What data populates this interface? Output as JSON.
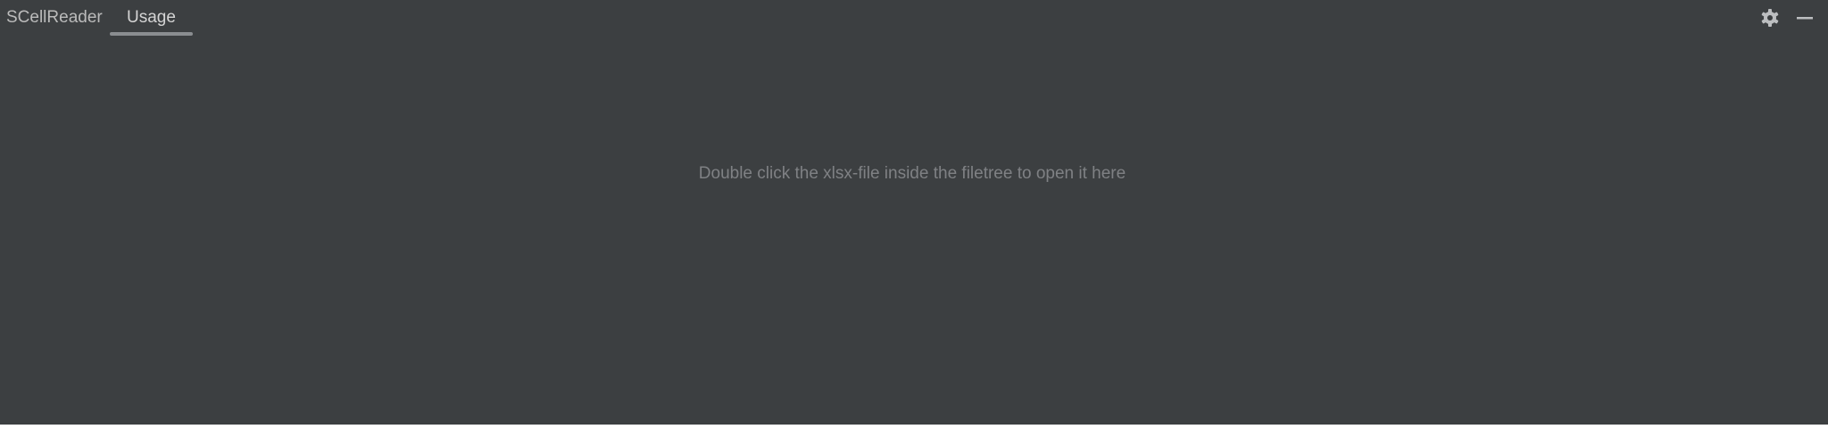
{
  "tool_window": {
    "title": "SCellReader",
    "tabs": [
      {
        "label": "Usage",
        "selected": true
      }
    ],
    "actions": [
      {
        "icon": "gear-icon"
      },
      {
        "icon": "minimize-icon"
      }
    ],
    "empty_text": "Double click the xlsx-file inside the filetree to open it here"
  },
  "colors": {
    "background": "#3c3f41",
    "text": "#bbbbbb",
    "muted_text": "#7f8184",
    "tab_underline": "#8a8d90",
    "icon": "#bcbec0"
  }
}
